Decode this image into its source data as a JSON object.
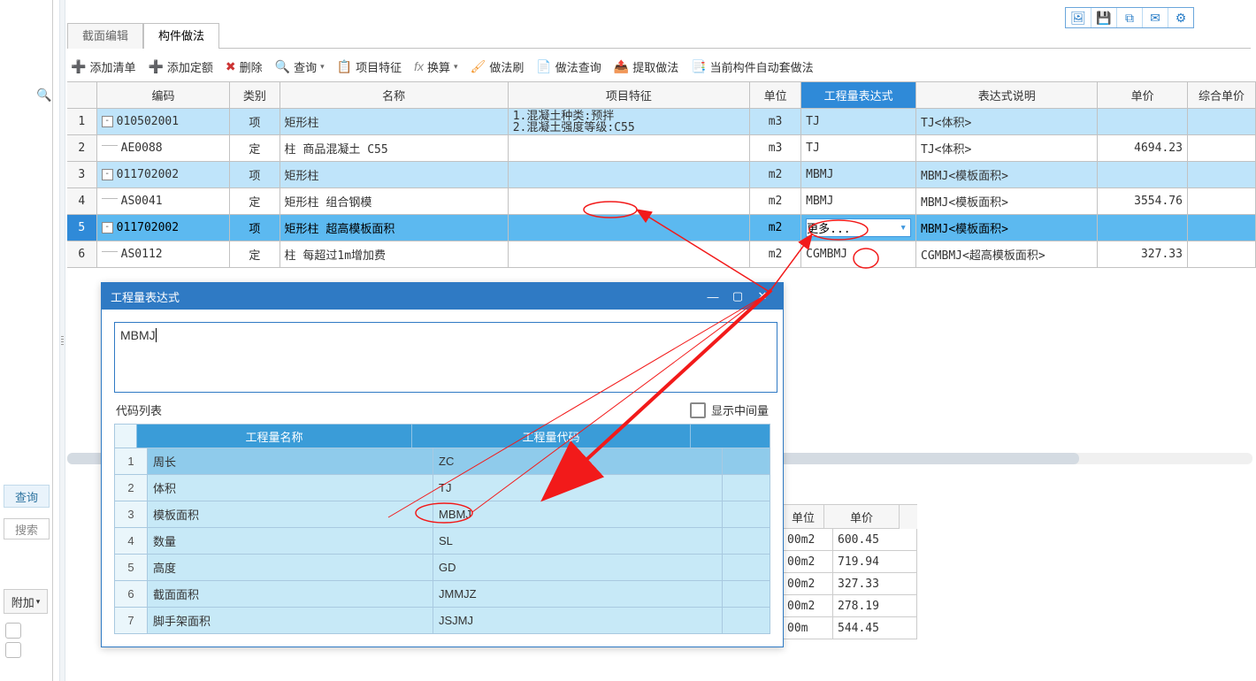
{
  "tabs": {
    "t0": "截面编辑",
    "t1": "构件做法"
  },
  "toolbar": {
    "add_list": "添加清单",
    "add_quota": "添加定额",
    "delete": "删除",
    "query": "查询",
    "feature": "项目特征",
    "calc": "换算",
    "method_brush": "做法刷",
    "method_query": "做法查询",
    "extract": "提取做法",
    "auto_method": "当前构件自动套做法"
  },
  "toolbar_icons": {
    "a": "🖼",
    "b": "💾",
    "c": "⧉",
    "d": "✉",
    "e": "⚙"
  },
  "columns": {
    "code": "编码",
    "kind": "类别",
    "name": "名称",
    "feat": "项目特征",
    "unit": "单位",
    "expr": "工程量表达式",
    "desc": "表达式说明",
    "price": "单价",
    "total": "综合单价"
  },
  "rows": [
    {
      "n": "1",
      "code": "010502001",
      "kind": "项",
      "name": "矩形柱",
      "feat": "1.混凝土种类:预拌\n2.混凝土强度等级:C55",
      "unit": "m3",
      "expr": "TJ",
      "desc": "TJ<体积>",
      "price": "",
      "hl": true,
      "exp": "-"
    },
    {
      "n": "2",
      "code": "AE0088",
      "kind": "定",
      "name": "柱 商品混凝土 C55",
      "feat": "",
      "unit": "m3",
      "expr": "TJ",
      "desc": "TJ<体积>",
      "price": "4694.23",
      "child": true
    },
    {
      "n": "3",
      "code": "011702002",
      "kind": "项",
      "name": "矩形柱",
      "feat": "",
      "unit": "m2",
      "expr": "MBMJ",
      "desc": "MBMJ<模板面积>",
      "price": "",
      "hl": true,
      "exp": "-"
    },
    {
      "n": "4",
      "code": "AS0041",
      "kind": "定",
      "name": "矩形柱 组合钢模",
      "feat": "",
      "unit": "m2",
      "expr": "MBMJ",
      "desc": "MBMJ<模板面积>",
      "price": "3554.76",
      "child": true
    },
    {
      "n": "5",
      "code": "011702002",
      "kind": "项",
      "name": "矩形柱 超高模板面积",
      "feat": "",
      "unit": "m2",
      "expr": "更多...",
      "desc": "MBMJ<模板面积>",
      "price": "",
      "sel": true,
      "exp": "-",
      "editing": true
    },
    {
      "n": "6",
      "code": "AS0112",
      "kind": "定",
      "name": "柱 每超过1m增加费",
      "feat": "",
      "unit": "m2",
      "expr": "CGMBMJ",
      "desc": "CGMBMJ<超高模板面积>",
      "price": "327.33",
      "child": true
    }
  ],
  "dialog": {
    "title": "工程量表达式",
    "input": "MBMJ",
    "sub": "代码列表",
    "chk": "显示中间量",
    "hdr0": "工程量名称",
    "hdr1": "工程量代码",
    "items": [
      {
        "n": "1",
        "name": "周长",
        "code": "ZC",
        "sel": true
      },
      {
        "n": "2",
        "name": "体积",
        "code": "TJ"
      },
      {
        "n": "3",
        "name": "模板面积",
        "code": "MBMJ"
      },
      {
        "n": "4",
        "name": "数量",
        "code": "SL"
      },
      {
        "n": "5",
        "name": "高度",
        "code": "GD"
      },
      {
        "n": "6",
        "name": "截面面积",
        "code": "JMMJZ"
      },
      {
        "n": "7",
        "name": "脚手架面积",
        "code": "JSJMJ"
      }
    ]
  },
  "bg_grid": {
    "h0": "单位",
    "h1": "单价",
    "rows": [
      {
        "u": "00m2",
        "p": "600.45"
      },
      {
        "u": "00m2",
        "p": "719.94"
      },
      {
        "u": "00m2",
        "p": "327.33"
      },
      {
        "u": "00m2",
        "p": "278.19"
      },
      {
        "u": "00m",
        "p": "544.45"
      }
    ]
  },
  "left": {
    "query": "查询",
    "search": "搜索",
    "attach": "附加"
  }
}
